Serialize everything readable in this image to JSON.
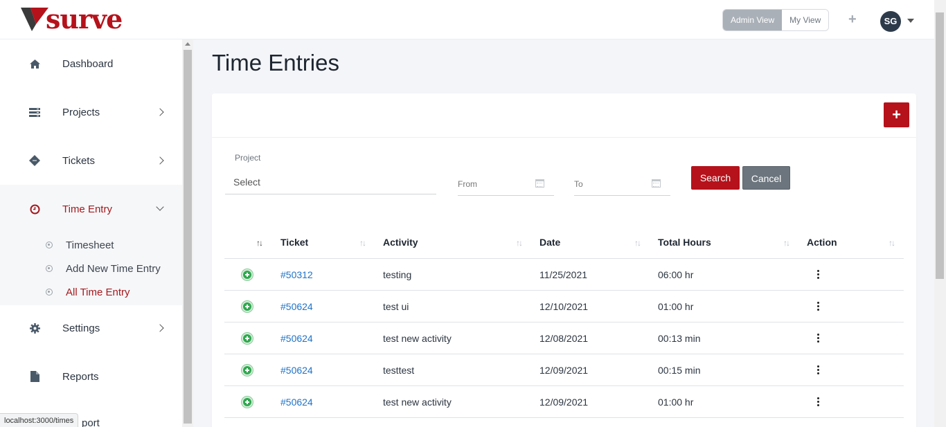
{
  "header": {
    "logo_text": "surve",
    "view_toggle": [
      "Admin View",
      "My View"
    ],
    "active_view": "Admin View",
    "avatar_initials": "SG"
  },
  "sidebar": {
    "items": [
      {
        "label": "Dashboard",
        "icon": "home-icon"
      },
      {
        "label": "Projects",
        "icon": "server-icon"
      },
      {
        "label": "Tickets",
        "icon": "ticket-icon"
      },
      {
        "label": "Time Entry",
        "icon": "clock-icon"
      },
      {
        "label": "Settings",
        "icon": "gear-icon"
      },
      {
        "label": "Reports",
        "icon": "file-icon"
      }
    ],
    "time_entry_sub": [
      {
        "label": "Timesheet"
      },
      {
        "label": "Add New Time Entry"
      },
      {
        "label": "All Time Entry"
      }
    ],
    "partial_item": "port"
  },
  "status_url": "localhost:3000/times",
  "page": {
    "title": "Time Entries"
  },
  "filters": {
    "project_label": "Project",
    "project_value": "Select",
    "from_placeholder": "From",
    "to_placeholder": "To",
    "search_label": "Search",
    "cancel_label": "Cancel"
  },
  "table": {
    "columns": [
      "Ticket",
      "Activity",
      "Date",
      "Total Hours",
      "Action"
    ],
    "rows": [
      {
        "ticket": "#50312",
        "activity": "testing",
        "date": "11/25/2021",
        "hours": "06:00 hr"
      },
      {
        "ticket": "#50624",
        "activity": "test ui",
        "date": "12/10/2021",
        "hours": "01:00 hr"
      },
      {
        "ticket": "#50624",
        "activity": "test new activity",
        "date": "12/08/2021",
        "hours": "00:13 min"
      },
      {
        "ticket": "#50624",
        "activity": "testtest",
        "date": "12/09/2021",
        "hours": "00:15 min"
      },
      {
        "ticket": "#50624",
        "activity": "test new activity",
        "date": "12/09/2021",
        "hours": "01:00 hr"
      }
    ]
  },
  "colors": {
    "brand": "#b5121b",
    "link": "#1f72c6",
    "secondary": "#6c757d"
  }
}
